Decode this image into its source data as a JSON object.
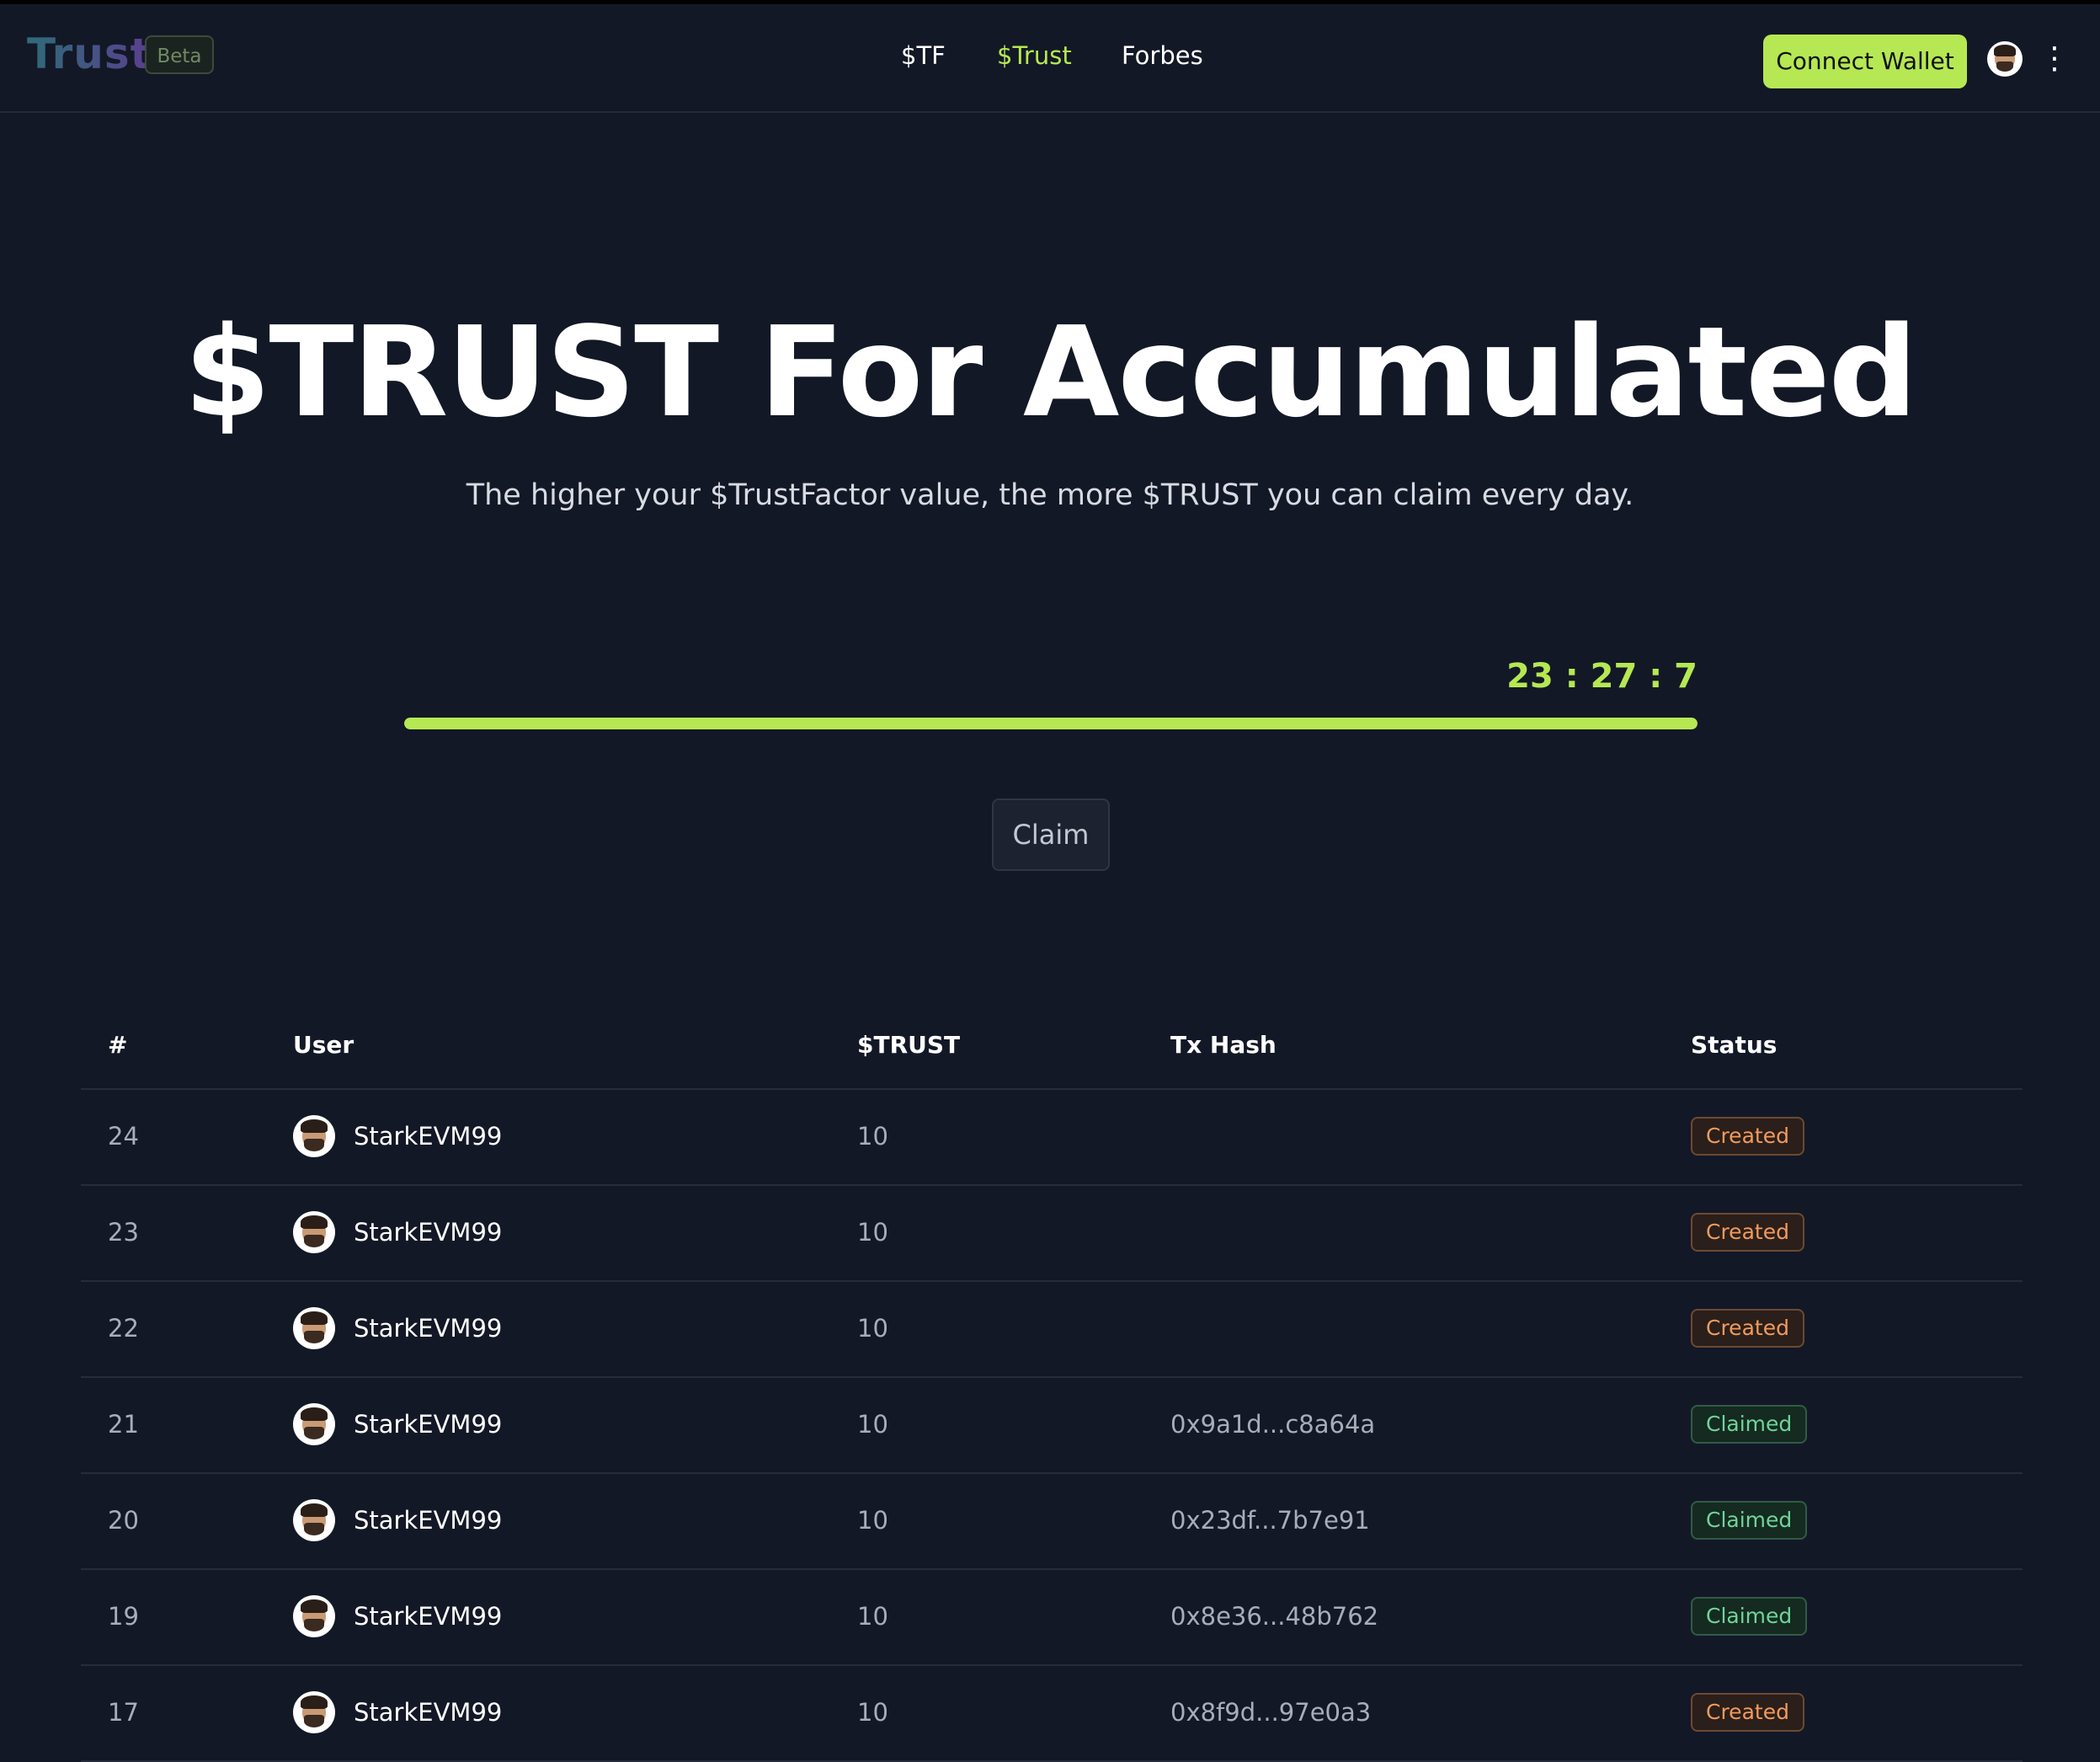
{
  "header": {
    "logo": "Trust",
    "beta_label": "Beta",
    "nav": [
      {
        "label": "$TF",
        "active": false
      },
      {
        "label": "$Trust",
        "active": true
      },
      {
        "label": "Forbes",
        "active": false
      }
    ],
    "connect_label": "Connect Wallet",
    "menu_icon": "kebab-icon"
  },
  "hero": {
    "title": "$TRUST For Accumulated",
    "subtitle": "The higher your $TrustFactor value, the more $TRUST you can claim every day.",
    "timer": "23 : 27 : 7",
    "progress": 1.0,
    "claim_label": "Claim"
  },
  "colors": {
    "background": "#131826",
    "accent": "#b5e853",
    "created": "#f29a5c",
    "claimed": "#6fd49a"
  },
  "table": {
    "headers": {
      "num": "#",
      "user": "User",
      "trust": "$TRUST",
      "hash": "Tx Hash",
      "status": "Status"
    },
    "rows": [
      {
        "num": "24",
        "user": "StarkEVM99",
        "trust": "10",
        "hash": "",
        "status": "Created"
      },
      {
        "num": "23",
        "user": "StarkEVM99",
        "trust": "10",
        "hash": "",
        "status": "Created"
      },
      {
        "num": "22",
        "user": "StarkEVM99",
        "trust": "10",
        "hash": "",
        "status": "Created"
      },
      {
        "num": "21",
        "user": "StarkEVM99",
        "trust": "10",
        "hash": "0x9a1d...c8a64a",
        "status": "Claimed"
      },
      {
        "num": "20",
        "user": "StarkEVM99",
        "trust": "10",
        "hash": "0x23df...7b7e91",
        "status": "Claimed"
      },
      {
        "num": "19",
        "user": "StarkEVM99",
        "trust": "10",
        "hash": "0x8e36...48b762",
        "status": "Claimed"
      },
      {
        "num": "17",
        "user": "StarkEVM99",
        "trust": "10",
        "hash": "0x8f9d...97e0a3",
        "status": "Created"
      }
    ]
  }
}
